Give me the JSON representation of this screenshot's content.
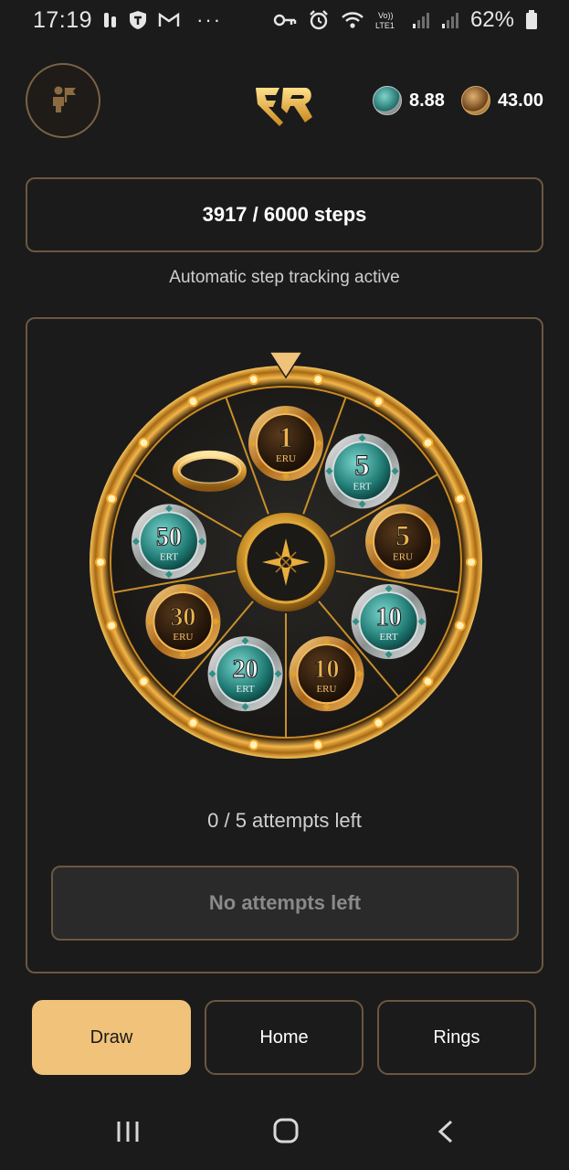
{
  "status_bar": {
    "time": "17:19",
    "icons_left": [
      "notification-icon",
      "shield-t-icon",
      "gmail-icon"
    ],
    "more": "···",
    "icons_right": [
      "key-icon",
      "alarm-icon",
      "wifi-icon",
      "volte-icon",
      "signal-icon",
      "signal-icon-2",
      "battery-icon"
    ],
    "volte_label": "Vo)) LTE1",
    "battery": "62%"
  },
  "header": {
    "avatar_icon": "person-flag-icon",
    "logo_icon": "er-logo-icon",
    "balances": [
      {
        "icon": "ert-coin-icon",
        "value": "8.88"
      },
      {
        "icon": "eru-coin-icon",
        "value": "43.00"
      }
    ]
  },
  "steps": {
    "text": "3917 / 6000 steps",
    "current": 3917,
    "goal": 6000,
    "tracking_text": "Automatic step tracking active"
  },
  "wheel": {
    "segments": [
      {
        "amount": "1",
        "currency": "ERU"
      },
      {
        "amount": "5",
        "currency": "ERT"
      },
      {
        "amount": "5",
        "currency": "ERU"
      },
      {
        "amount": "10",
        "currency": "ERT"
      },
      {
        "amount": "10",
        "currency": "ERU"
      },
      {
        "amount": "20",
        "currency": "ERT"
      },
      {
        "amount": "30",
        "currency": "ERU"
      },
      {
        "amount": "50",
        "currency": "ERT"
      },
      {
        "amount": "",
        "currency": "RING"
      }
    ],
    "center_icon": "compass-star-icon",
    "pointer_icon": "pointer-triangle-icon",
    "colors": {
      "gold": "#e0a030",
      "ert": "#2f8f86",
      "eru": "#8a5522"
    }
  },
  "attempts": {
    "text": "0 / 5 attempts left",
    "left": 0,
    "total": 5,
    "button_label": "No attempts left"
  },
  "nav": {
    "buttons": [
      {
        "label": "Draw",
        "active": true
      },
      {
        "label": "Home",
        "active": false
      },
      {
        "label": "Rings",
        "active": false
      }
    ],
    "active_color": "#f0c27a"
  },
  "system_nav": [
    "recent-apps-icon",
    "home-icon",
    "back-icon"
  ]
}
